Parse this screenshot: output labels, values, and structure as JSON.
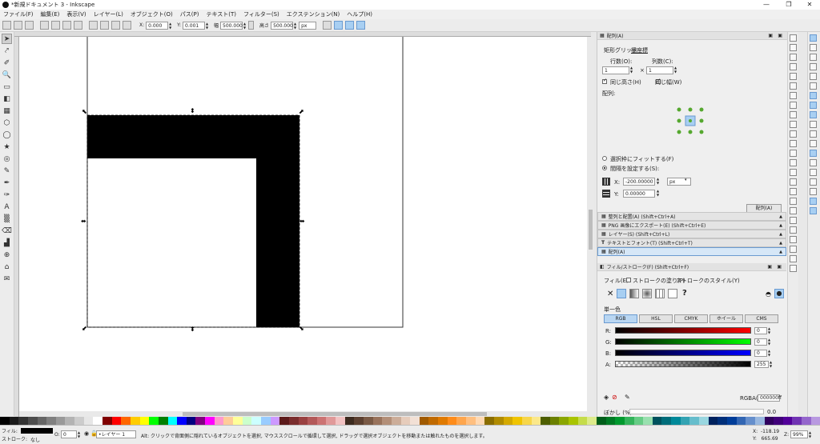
{
  "window": {
    "title": "*新規ドキュメント 3 - Inkscape",
    "minimize": "—",
    "maximize": "❐",
    "close": "✕"
  },
  "menu": [
    "ファイル(F)",
    "編集(E)",
    "表示(V)",
    "レイヤー(L)",
    "オブジェクト(O)",
    "パス(P)",
    "テキスト(T)",
    "フィルター(S)",
    "エクステンション(N)",
    "ヘルプ(H)"
  ],
  "toolbar": {
    "x_label": "X:",
    "x_value": "0.000",
    "y_label": "Y:",
    "y_value": "0.001",
    "w_label": "幅",
    "w_value": "500.000",
    "h_label": "高さ",
    "h_value": "500.000",
    "unit": "px"
  },
  "tools": [
    "➤",
    "⤤",
    "✐",
    "🔍",
    "▭",
    "◧",
    "▦",
    "⬡",
    "◯",
    "★",
    "◎",
    "✎",
    "✒",
    "✑",
    "A",
    "▒",
    "⌫",
    "▟",
    "⊕",
    "⌂",
    "✉"
  ],
  "panel": {
    "title": "配列(A)",
    "tabs": [
      "矩形グリッド",
      "極座標"
    ],
    "rows_label": "行数(O):",
    "cols_label": "列数(C):",
    "rows_value": "1",
    "cols_value": "1",
    "times": "×",
    "equal_height": "同じ高さ(H)",
    "equal_width": "同じ幅(W)",
    "align_label": "配列:",
    "fit_option": "選択枠にフィットする(F)",
    "spacing_option": "間隔を設定する(S):",
    "x_label": "X:",
    "x_value": "-200.00000",
    "y_label": "Y:",
    "y_value": "0.00000",
    "unit": "px",
    "arrange_button": "配列(A)"
  },
  "docks": [
    {
      "icon": "▦",
      "label": "整列と配置(A) (Shift+Ctrl+A)"
    },
    {
      "icon": "▦",
      "label": "PNG 画像にエクスポート(E) (Shift+Ctrl+E)"
    },
    {
      "icon": "▦",
      "label": "レイヤー(S) (Shift+Ctrl+L)"
    },
    {
      "icon": "T",
      "label": "テキストとフォント(T) (Shift+Ctrl+T)"
    },
    {
      "icon": "▦",
      "label": "配列(A)"
    }
  ],
  "fill": {
    "header": "フィル/ストローク(F) (Shift+Ctrl+F)",
    "tabs": [
      "フィル(E)",
      "ストロークの塗り(P)",
      "ストロークのスタイル(Y)"
    ],
    "paint_x": "✕",
    "paint_unknown": "?",
    "mode_label": "単一色",
    "color_tabs": [
      "RGB",
      "HSL",
      "CMYK",
      "ホイール",
      "CMS"
    ],
    "channels": [
      {
        "label": "R:",
        "value": "0",
        "color": "#ff0000"
      },
      {
        "label": "G:",
        "value": "0",
        "color": "#00ff00"
      },
      {
        "label": "B:",
        "value": "0",
        "color": "#0000ff"
      },
      {
        "label": "A:",
        "value": "255",
        "color": "#000000"
      }
    ],
    "rgba_label": "RGBA():",
    "rgba_value": "000000ff",
    "blur_label": "ぼかし (%)",
    "blur_value": "0.0"
  },
  "status": {
    "fill_label": "フィル:",
    "stroke_label": "ストローク:",
    "stroke_value": "なし",
    "opacity_label": "O:",
    "opacity_value": "0",
    "layer": "•レイヤー 1",
    "message": "Alt: クリックで背面側に隠れているオブジェクトを選択, マウススクロールで循環して選択, ドラッグで選択オブジェクトを移動または触れたものを選択します。",
    "x_coord": "X:  -118.19",
    "y_coord": "Y:   665.69",
    "zoom_label": "Z:",
    "zoom_value": "99%"
  },
  "colors": {
    "accent": "#a8cff2",
    "selection": "#6a9ad0",
    "node_green": "#55a82f",
    "shape_fill": "#000000"
  },
  "palette": [
    "#000000",
    "#1a1a1a",
    "#333333",
    "#4d4d4d",
    "#666666",
    "#808080",
    "#999999",
    "#b3b3b3",
    "#cccccc",
    "#e6e6e6",
    "#ffffff",
    "#800000",
    "#ff0000",
    "#ff6600",
    "#ffcc00",
    "#ffff00",
    "#00ff00",
    "#008000",
    "#00ffff",
    "#0000ff",
    "#000080",
    "#800080",
    "#ff00ff",
    "#ff99cc",
    "#ffcc99",
    "#ffff99",
    "#ccffcc",
    "#ccffff",
    "#99ccff",
    "#cc99ff",
    "#5c1a1a",
    "#7a2d2d",
    "#994040",
    "#b35959",
    "#cc7373",
    "#e09999",
    "#f2c2c2",
    "#3d2b1f",
    "#5c4030",
    "#7a5a45",
    "#99735c",
    "#b38f78",
    "#ccad99",
    "#e6ccbb",
    "#f2e0d5",
    "#a05a00",
    "#c06a00",
    "#e07a00",
    "#ff8c1a",
    "#ffa64d",
    "#ffbf80",
    "#ffd9b3",
    "#8a6d00",
    "#b08b00",
    "#d4a900",
    "#f0c400",
    "#f7d64a",
    "#fbe88a",
    "#4d5e00",
    "#6b8000",
    "#8aa600",
    "#a9c400",
    "#c5dc4a",
    "#ddeb8a",
    "#005e1a",
    "#007a24",
    "#00992e",
    "#33b35a",
    "#66cc85",
    "#99e0af",
    "#00525e",
    "#006d7a",
    "#008999",
    "#33a3b3",
    "#66bdcc",
    "#99d6e0",
    "#00225e",
    "#002f7a",
    "#003d99",
    "#3366b3",
    "#668fcc",
    "#99b8e0",
    "#30005e",
    "#40007a",
    "#520099",
    "#7033b3",
    "#9466cc",
    "#b899e0"
  ]
}
